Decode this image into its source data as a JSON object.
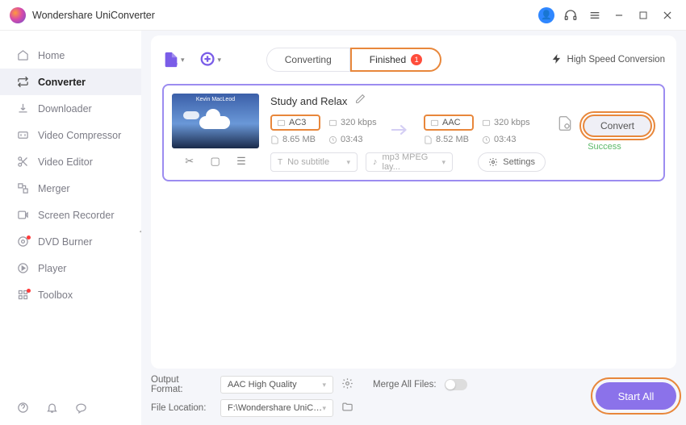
{
  "app": {
    "title": "Wondershare UniConverter"
  },
  "sidebar": {
    "items": [
      {
        "label": "Home"
      },
      {
        "label": "Converter"
      },
      {
        "label": "Downloader"
      },
      {
        "label": "Video Compressor"
      },
      {
        "label": "Video Editor"
      },
      {
        "label": "Merger"
      },
      {
        "label": "Screen Recorder"
      },
      {
        "label": "DVD Burner"
      },
      {
        "label": "Player"
      },
      {
        "label": "Toolbox"
      }
    ]
  },
  "tabs": {
    "converting": "Converting",
    "finished": "Finished",
    "finishedCount": "1"
  },
  "hsc": {
    "label": "High Speed Conversion"
  },
  "file": {
    "title": "Study and Relax",
    "thumbAuthor": "Kevin MacLeod",
    "src": {
      "format": "AC3",
      "bitrate": "320 kbps",
      "size": "8.65 MB",
      "duration": "03:43"
    },
    "dst": {
      "format": "AAC",
      "bitrate": "320 kbps",
      "size": "8.52 MB",
      "duration": "03:43"
    },
    "subtitle": "No subtitle",
    "audioPreset": "mp3 MPEG lay...",
    "settings": "Settings",
    "convert": "Convert",
    "status": "Success"
  },
  "footer": {
    "outputLabel": "Output Format:",
    "outputValue": "AAC High Quality",
    "locationLabel": "File Location:",
    "locationValue": "F:\\Wondershare UniConverter",
    "mergeLabel": "Merge All Files:",
    "startAll": "Start All"
  }
}
